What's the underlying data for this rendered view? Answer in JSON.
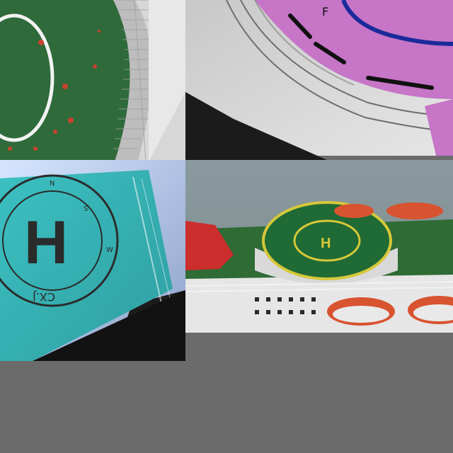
{
  "collage": {
    "panels": [
      {
        "name": "green-oval-helipad"
      },
      {
        "name": "pink-circular-helipad"
      },
      {
        "name": "teal-h-landing-pad"
      },
      {
        "name": "ship-model-helideck"
      }
    ],
    "teal_pad": {
      "h_letter": "H",
      "markings": [
        "N",
        "W",
        "S"
      ],
      "brand_text": "CX.J"
    },
    "ship_pad": {
      "h_letter": "H"
    },
    "pink_pad": {
      "marking": "F"
    },
    "colors": {
      "background": "#6b6b6b",
      "green_field": "#2f6a3a",
      "pink_pad": "#c675c7",
      "teal_pad": "#38b4b6",
      "ship_deck": "#2f6b34",
      "lifeboat_orange": "#d8532f",
      "helipad_yellow": "#d6c83a"
    }
  }
}
